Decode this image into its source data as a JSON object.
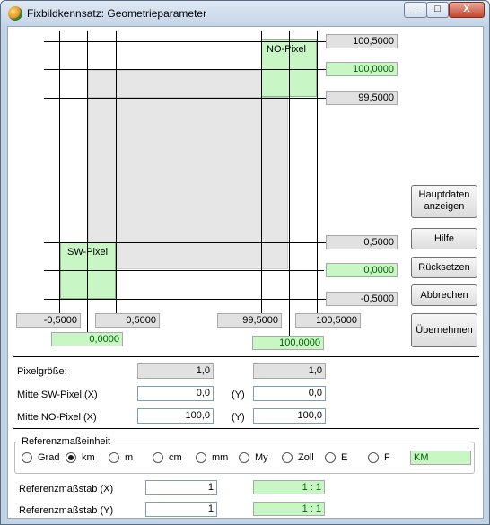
{
  "window": {
    "title": "Fixbildkennsatz: Geometrieparameter",
    "min": "_",
    "max": "□",
    "close": "X"
  },
  "diagram": {
    "no_label": "NO-Pixel",
    "sw_label": "SW-Pixel",
    "y_top_outer": "100,5000",
    "y_top_center": "100,0000",
    "y_top_inner": "99,5000",
    "y_bot_inner": "0,5000",
    "y_bot_center": "0,0000",
    "y_bot_outer": "-0,5000",
    "x_left_outer": "-0,5000",
    "x_left_center": "0,0000",
    "x_left_inner": "0,5000",
    "x_right_inner": "99,5000",
    "x_right_center": "100,0000",
    "x_right_outer": "100,5000"
  },
  "buttons": {
    "hauptdaten": [
      "Hauptdaten",
      "anzeigen"
    ],
    "hilfe": "Hilfe",
    "ruecksetzen": "Rücksetzen",
    "abbrechen": "Abbrechen",
    "uebernehmen": "Übernehmen"
  },
  "params": {
    "pixelgroesse_label": "Pixelgröße:",
    "pixel_x": "1,0",
    "pixel_y": "1,0",
    "sw_label": "Mitte SW-Pixel (X)",
    "sw_x": "0,0",
    "sw_y": "0,0",
    "no_label": "Mitte NO-Pixel (X)",
    "no_x": "100,0",
    "no_y": "100,0",
    "y_tag": "(Y)"
  },
  "einheit": {
    "legend": "Referenzmaßeinheit",
    "options": [
      "Grad",
      "km",
      "m",
      "cm",
      "mm",
      "My",
      "Zoll",
      "E",
      "F"
    ],
    "selected": "km",
    "display": "KM"
  },
  "massstab": {
    "x_label": "Referenzmaßstab (X)",
    "x_value": "1",
    "x_ratio": "1 : 1",
    "y_label": "Referenzmaßstab (Y)",
    "y_value": "1",
    "y_ratio": "1 : 1"
  }
}
